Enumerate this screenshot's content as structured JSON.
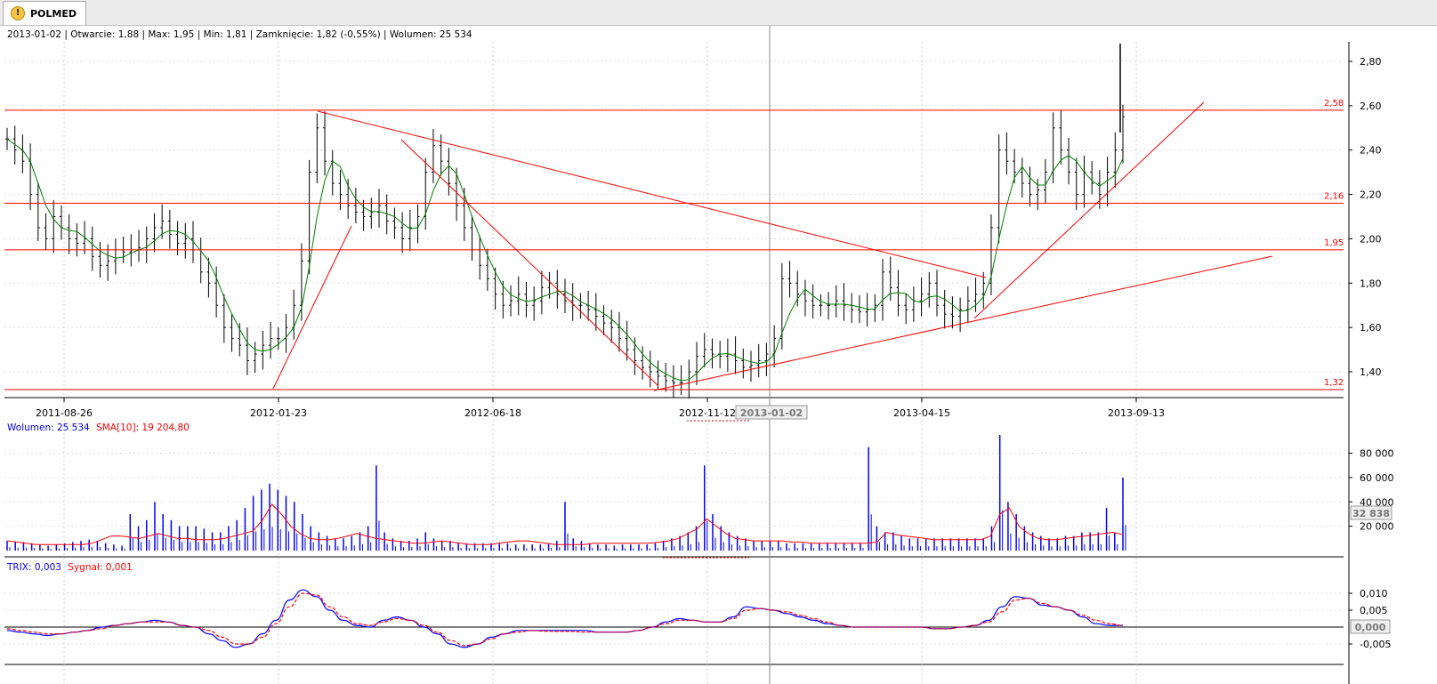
{
  "tab": {
    "icon": "warning-icon",
    "label": "POLMED"
  },
  "price_panel": {
    "info": "2013-01-02 | Otwarcie: 1,88 | Max: 1,95 | Min: 1,81 | Zamknięcie: 1,82 (-0,55%)  | Wolumen: 25 534",
    "h_levels": [
      "2,58",
      "2,16",
      "1,95",
      "1,32"
    ],
    "y_ticks": [
      "2,80",
      "2,60",
      "2,40",
      "2,20",
      "2,00",
      "1,80",
      "1,60",
      "1,40"
    ],
    "x_ticks": [
      "2011-08-26",
      "2012-01-23",
      "2012-06-18",
      "2012-11-12",
      "2013-04-15",
      "2013-09-13"
    ],
    "cursor_date": "2013-01-02"
  },
  "volume_panel": {
    "legend_volume": "Wolumen: 25 534",
    "legend_sma": "SMA[10]: 19 204,80",
    "y_ticks": [
      "80 000",
      "60 000",
      "40 000",
      "20 000"
    ],
    "cursor_value": "32 838"
  },
  "trix_panel": {
    "legend_trix": "TRIX: 0,003",
    "legend_signal": "Sygnał: 0,001",
    "y_ticks": [
      "0,010",
      "0,005",
      "-0,005"
    ],
    "cursor_value": "0,000"
  },
  "colors": {
    "price_bar": "#000000",
    "ma": "#008000",
    "trendline": "#ff0000",
    "volume": "#0000ff",
    "sma": "#ff0000",
    "trix": "#0000ff",
    "signal": "#ff0000"
  },
  "chart_data": [
    {
      "type": "ohlc",
      "x_range": [
        "2011-07-01",
        "2013-09-16"
      ],
      "ylim": [
        1.3,
        2.9
      ],
      "closes": [
        2.45,
        2.4,
        2.35,
        2.2,
        2.05,
        2.0,
        2.1,
        2.05,
        2.0,
        1.98,
        2.0,
        1.92,
        1.88,
        1.9,
        1.95,
        1.94,
        1.95,
        1.96,
        2.0,
        2.05,
        2.08,
        2.02,
        1.98,
        2.0,
        1.95,
        1.85,
        1.8,
        1.7,
        1.6,
        1.55,
        1.52,
        1.45,
        1.48,
        1.52,
        1.55,
        1.55,
        1.6,
        1.7,
        1.9,
        2.3,
        2.5,
        2.35,
        2.25,
        2.2,
        2.15,
        2.12,
        2.1,
        2.12,
        2.15,
        2.08,
        2.05,
        2.0,
        2.05,
        2.1,
        2.3,
        2.42,
        2.35,
        2.25,
        2.15,
        2.05,
        1.95,
        1.88,
        1.82,
        1.75,
        1.7,
        1.72,
        1.75,
        1.7,
        1.72,
        1.78,
        1.8,
        1.75,
        1.72,
        1.7,
        1.7,
        1.68,
        1.65,
        1.62,
        1.6,
        1.55,
        1.5,
        1.45,
        1.42,
        1.4,
        1.38,
        1.36,
        1.35,
        1.35,
        1.4,
        1.47,
        1.5,
        1.48,
        1.47,
        1.48,
        1.45,
        1.42,
        1.43,
        1.45,
        1.48,
        1.55,
        1.82,
        1.8,
        1.75,
        1.72,
        1.7,
        1.7,
        1.7,
        1.72,
        1.7,
        1.68,
        1.67,
        1.68,
        1.7,
        1.85,
        1.78,
        1.7,
        1.68,
        1.72,
        1.75,
        1.8,
        1.7,
        1.66,
        1.65,
        1.68,
        1.72,
        1.75,
        1.8,
        2.05,
        2.4,
        2.35,
        2.3,
        2.25,
        2.2,
        2.22,
        2.3,
        2.5,
        2.4,
        2.3,
        2.2,
        2.3,
        2.25,
        2.2,
        2.3,
        2.4,
        2.55
      ],
      "horizontal_lines": [
        2.58,
        2.16,
        1.95,
        1.32
      ],
      "xlabel": "",
      "ylabel": ""
    },
    {
      "type": "bar",
      "series": [
        {
          "name": "Wolumen",
          "values": [
            8000,
            7000,
            7000,
            6000,
            5000,
            4000,
            5000,
            6000,
            7000,
            8000,
            9000,
            8000,
            6000,
            5000,
            4000,
            30000,
            20000,
            25000,
            40000,
            30000,
            25000,
            20000,
            20000,
            20000,
            18000,
            15000,
            15000,
            20000,
            25000,
            35000,
            45000,
            50000,
            55000,
            50000,
            45000,
            40000,
            30000,
            20000,
            15000,
            12000,
            10000,
            10000,
            12000,
            15000,
            20000,
            70000,
            15000,
            10000,
            8000,
            8000,
            10000,
            15000,
            10000,
            8000,
            8000,
            6000,
            6000,
            6000,
            6000,
            6000,
            6000,
            6000,
            5000,
            5000,
            5000,
            5000,
            6000,
            8000,
            40000,
            10000,
            8000,
            6000,
            5000,
            5000,
            4000,
            5000,
            5000,
            5000,
            5000,
            6000,
            8000,
            10000,
            12000,
            15000,
            20000,
            70000,
            30000,
            20000,
            15000,
            12000,
            10000,
            8000,
            8000,
            8000,
            8000,
            6000,
            6000,
            6000,
            6000,
            6000,
            6000,
            6000,
            6000,
            6000,
            6000,
            85000,
            20000,
            15000,
            15000,
            12000,
            10000,
            10000,
            10000,
            10000,
            10000,
            10000,
            10000,
            10000,
            10000,
            10000,
            20000,
            95000,
            40000,
            30000,
            20000,
            15000,
            12000,
            10000,
            10000,
            12000,
            12000,
            15000,
            15000,
            15000,
            35000,
            15000,
            60000
          ]
        },
        {
          "name": "SMA[10]",
          "values": [
            8000,
            7000,
            6000,
            5000,
            5000,
            5000,
            5000,
            5000,
            5000,
            6000,
            9000,
            12000,
            12000,
            11000,
            10000,
            12000,
            14000,
            12000,
            10000,
            10000,
            9000,
            9000,
            9000,
            10000,
            12000,
            14000,
            16000,
            25000,
            38000,
            30000,
            20000,
            14000,
            10000,
            9000,
            9000,
            10000,
            12000,
            14000,
            12000,
            10000,
            9000,
            8000,
            7000,
            6000,
            6000,
            7000,
            8000,
            7000,
            6000,
            5000,
            5000,
            5000,
            6000,
            7000,
            8000,
            8000,
            7000,
            6000,
            5000,
            5000,
            5000,
            5000,
            6000,
            6000,
            6000,
            6000,
            6000,
            6000,
            6000,
            7000,
            8000,
            10000,
            14000,
            18000,
            26000,
            20000,
            14000,
            10000,
            9000,
            8000,
            8000,
            8000,
            8000,
            7000,
            7000,
            6000,
            6000,
            6000,
            6000,
            6000,
            6000,
            6000,
            7000,
            15000,
            13000,
            12000,
            11000,
            10000,
            9000,
            9000,
            9000,
            9000,
            9000,
            9000,
            12000,
            30000,
            35000,
            20000,
            14000,
            10000,
            9000,
            9000,
            10000,
            11000,
            12000,
            13000,
            14000,
            15000,
            13000
          ]
        }
      ],
      "ylim": [
        0,
        95000
      ]
    },
    {
      "type": "line",
      "series": [
        {
          "name": "TRIX",
          "values": [
            -0.001,
            -0.0015,
            -0.002,
            -0.0025,
            -0.002,
            -0.0015,
            -0.001,
            0.0,
            0.0005,
            0.001,
            0.0015,
            0.002,
            0.0015,
            0.0005,
            0.0,
            -0.002,
            -0.004,
            -0.006,
            -0.005,
            -0.002,
            0.002,
            0.008,
            0.011,
            0.009,
            0.005,
            0.002,
            0.0005,
            0.0,
            0.002,
            0.003,
            0.002,
            0.0,
            -0.002,
            -0.005,
            -0.006,
            -0.005,
            -0.003,
            -0.002,
            -0.001,
            -0.001,
            -0.001,
            -0.001,
            -0.001,
            -0.001,
            -0.0015,
            -0.0015,
            -0.0015,
            -0.001,
            0.0,
            0.0015,
            0.0025,
            0.002,
            0.0015,
            0.0015,
            0.003,
            0.006,
            0.0055,
            0.005,
            0.004,
            0.003,
            0.002,
            0.001,
            0.0005,
            0.0,
            0.0,
            0.0,
            0.0,
            0.0,
            0.0,
            -0.0005,
            -0.0005,
            0.0,
            0.0005,
            0.002,
            0.006,
            0.009,
            0.0085,
            0.0065,
            0.006,
            0.005,
            0.003,
            0.001,
            0.0005,
            0.0005
          ]
        },
        {
          "name": "Sygnał",
          "values": [
            -0.0005,
            -0.001,
            -0.0015,
            -0.002,
            -0.002,
            -0.0015,
            -0.001,
            -0.0005,
            0.0005,
            0.001,
            0.0015,
            0.0015,
            0.0015,
            0.0005,
            0.0,
            -0.001,
            -0.003,
            -0.005,
            -0.005,
            -0.003,
            0.001,
            0.006,
            0.01,
            0.0095,
            0.006,
            0.003,
            0.001,
            0.0005,
            0.0015,
            0.0025,
            0.002,
            0.0005,
            -0.0015,
            -0.004,
            -0.0055,
            -0.005,
            -0.0035,
            -0.002,
            -0.0015,
            -0.001,
            -0.0012,
            -0.0013,
            -0.0013,
            -0.0015,
            -0.0015,
            -0.0015,
            -0.0015,
            -0.001,
            0.0,
            0.001,
            0.002,
            0.002,
            0.0015,
            0.0015,
            0.0025,
            0.005,
            0.0055,
            0.005,
            0.0045,
            0.0035,
            0.0025,
            0.0015,
            0.0005,
            0.0,
            0.0,
            0.0,
            0.0,
            0.0,
            0.0,
            -0.0005,
            -0.0005,
            0.0,
            0.0005,
            0.0015,
            0.0045,
            0.008,
            0.0085,
            0.007,
            0.006,
            0.005,
            0.0035,
            0.002,
            0.001,
            0.0005
          ]
        }
      ],
      "ylim": [
        -0.008,
        0.015
      ]
    }
  ]
}
